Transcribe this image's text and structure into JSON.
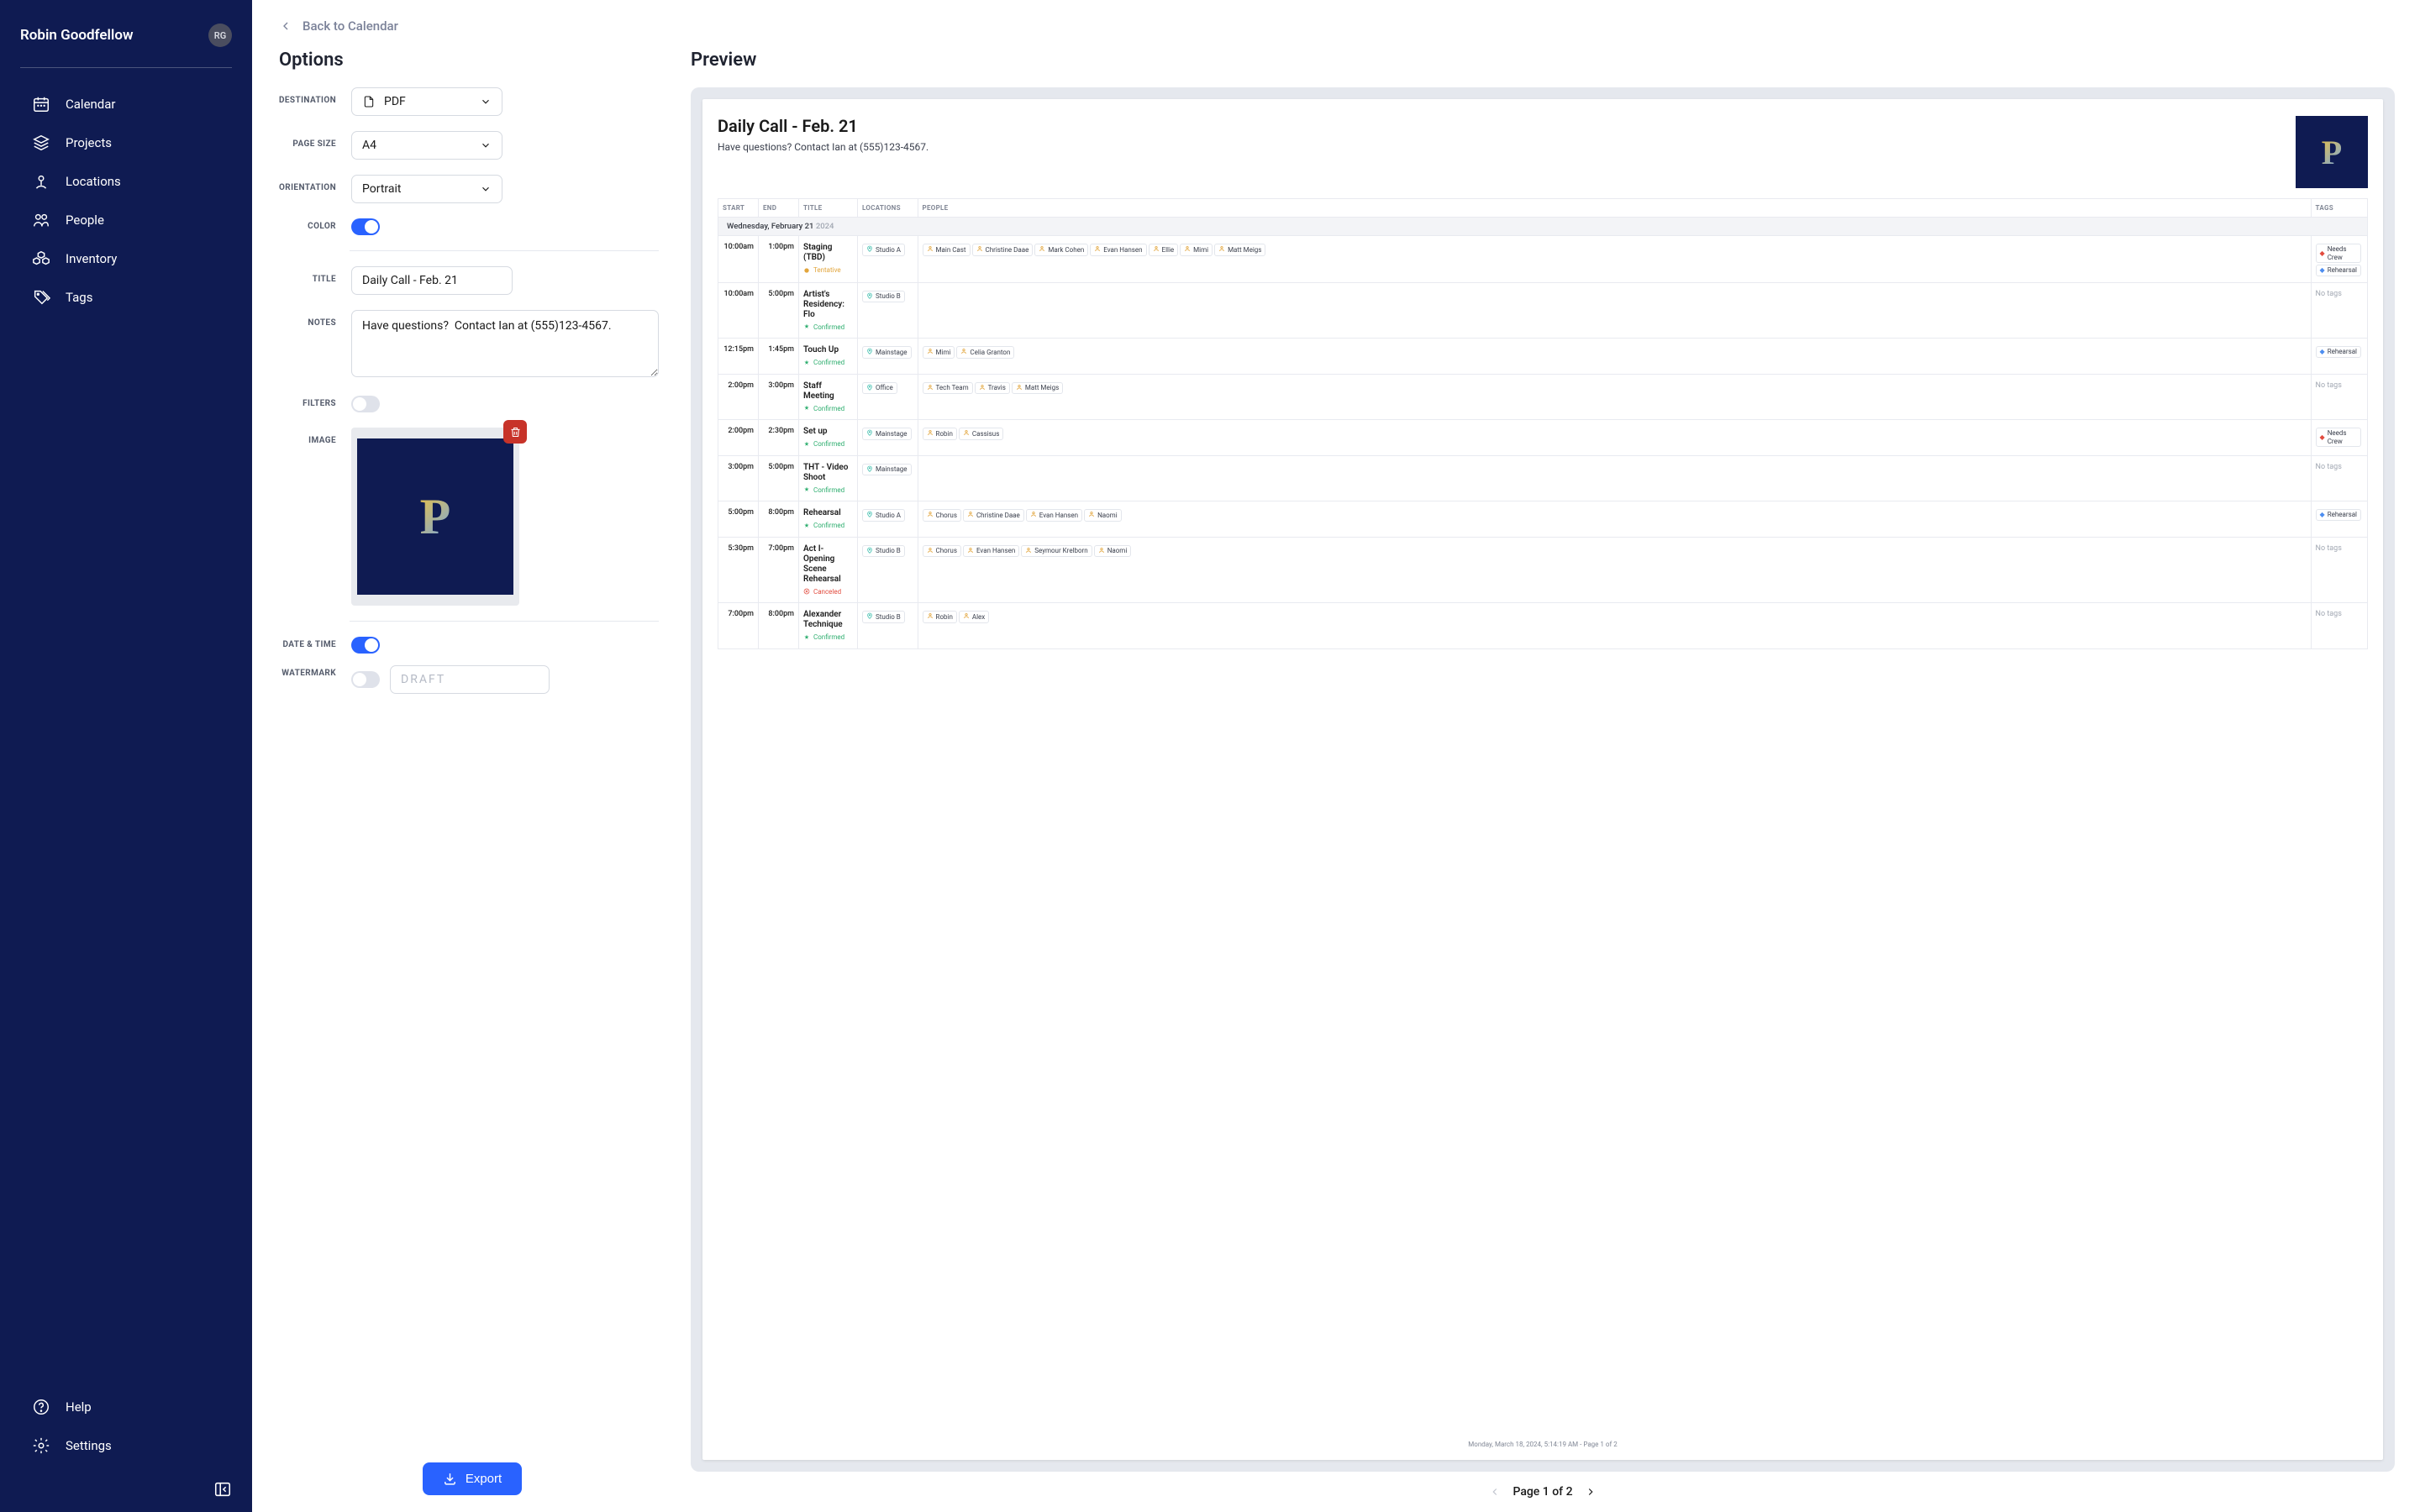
{
  "user": {
    "name": "Robin Goodfellow",
    "initials": "RG"
  },
  "sidebar": {
    "items": [
      {
        "label": "Calendar"
      },
      {
        "label": "Projects"
      },
      {
        "label": "Locations"
      },
      {
        "label": "People"
      },
      {
        "label": "Inventory"
      },
      {
        "label": "Tags"
      }
    ],
    "footer": [
      {
        "label": "Help"
      },
      {
        "label": "Settings"
      }
    ]
  },
  "back": {
    "label": "Back to Calendar"
  },
  "options": {
    "heading": "Options",
    "labels": {
      "destination": "DESTINATION",
      "page_size": "PAGE SIZE",
      "orientation": "ORIENTATION",
      "color": "COLOR",
      "title": "TITLE",
      "notes": "NOTES",
      "filters": "FILTERS",
      "image": "IMAGE",
      "datetime": "DATE & TIME",
      "watermark": "WATERMARK"
    },
    "destination": "PDF",
    "page_size": "A4",
    "orientation": "Portrait",
    "color_on": true,
    "title": "Daily Call - Feb. 21",
    "notes": "Have questions?  Contact Ian at (555)123-4567.",
    "filters_on": false,
    "datetime_on": true,
    "watermark_on": false,
    "watermark_placeholder": "DRAFT"
  },
  "export_label": "Export",
  "preview": {
    "heading": "Preview",
    "title": "Daily Call - Feb. 21",
    "notes": "Have questions? Contact Ian at (555)123-4567.",
    "columns": [
      "START",
      "END",
      "TITLE",
      "LOCATIONS",
      "PEOPLE",
      "TAGS"
    ],
    "date_row_main": "Wednesday, February 21",
    "date_row_year": "2024",
    "events": [
      {
        "start": "10:00am",
        "end": "1:00pm",
        "title": "Staging (TBD)",
        "status": "Tentative",
        "status_c": "st-tentative",
        "locs": [
          "Studio A"
        ],
        "people": [
          "Main Cast",
          "Christine Daae",
          "Mark Cohen",
          "Evan Hansen",
          "Ellie",
          "Mimi",
          "Matt Meigs"
        ],
        "tags": [
          "Needs Crew",
          "Rehearsal"
        ],
        "notags": false
      },
      {
        "start": "10:00am",
        "end": "5:00pm",
        "title": "Artist's Residency: Flo",
        "status": "Confirmed",
        "status_c": "st-confirmed",
        "locs": [
          "Studio B"
        ],
        "people": [],
        "tags": [],
        "notags": true
      },
      {
        "start": "12:15pm",
        "end": "1:45pm",
        "title": "Touch Up",
        "status": "Confirmed",
        "status_c": "st-confirmed",
        "locs": [
          "Mainstage"
        ],
        "people": [
          "Mimi",
          "Celia Granton"
        ],
        "tags": [
          "Rehearsal"
        ],
        "notags": false
      },
      {
        "start": "2:00pm",
        "end": "3:00pm",
        "title": "Staff Meeting",
        "status": "Confirmed",
        "status_c": "st-confirmed",
        "locs": [
          "Office"
        ],
        "people": [
          "Tech Team",
          "Travis",
          "Matt Meigs"
        ],
        "tags": [],
        "notags": true
      },
      {
        "start": "2:00pm",
        "end": "2:30pm",
        "title": "Set up",
        "status": "Confirmed",
        "status_c": "st-confirmed",
        "locs": [
          "Mainstage"
        ],
        "people": [
          "Robin",
          "Cassisus"
        ],
        "tags": [
          "Needs Crew"
        ],
        "notags": false
      },
      {
        "start": "3:00pm",
        "end": "5:00pm",
        "title": "THT - Video Shoot",
        "status": "Confirmed",
        "status_c": "st-confirmed",
        "locs": [
          "Mainstage"
        ],
        "people": [],
        "tags": [],
        "notags": true
      },
      {
        "start": "5:00pm",
        "end": "8:00pm",
        "title": "Rehearsal",
        "status": "Confirmed",
        "status_c": "st-confirmed",
        "locs": [
          "Studio A"
        ],
        "people": [
          "Chorus",
          "Christine Daae",
          "Evan Hansen",
          "Naomi"
        ],
        "tags": [
          "Rehearsal"
        ],
        "notags": false
      },
      {
        "start": "5:30pm",
        "end": "7:00pm",
        "title": "Act I- Opening Scene Rehearsal",
        "status": "Canceled",
        "status_c": "st-cancel",
        "locs": [
          "Studio B"
        ],
        "people": [
          "Chorus",
          "Evan Hansen",
          "Seymour Krelborn",
          "Naomi"
        ],
        "tags": [],
        "notags": true
      },
      {
        "start": "7:00pm",
        "end": "8:00pm",
        "title": "Alexander Technique",
        "status": "Confirmed",
        "status_c": "st-confirmed",
        "locs": [
          "Studio B"
        ],
        "people": [
          "Robin",
          "Alex"
        ],
        "tags": [],
        "notags": true
      }
    ],
    "footer": "Monday, March 18, 2024, 5:14:19 AM - Page 1 of 2",
    "no_tags_label": "No tags"
  },
  "pager": {
    "label": "Page 1 of 2"
  }
}
